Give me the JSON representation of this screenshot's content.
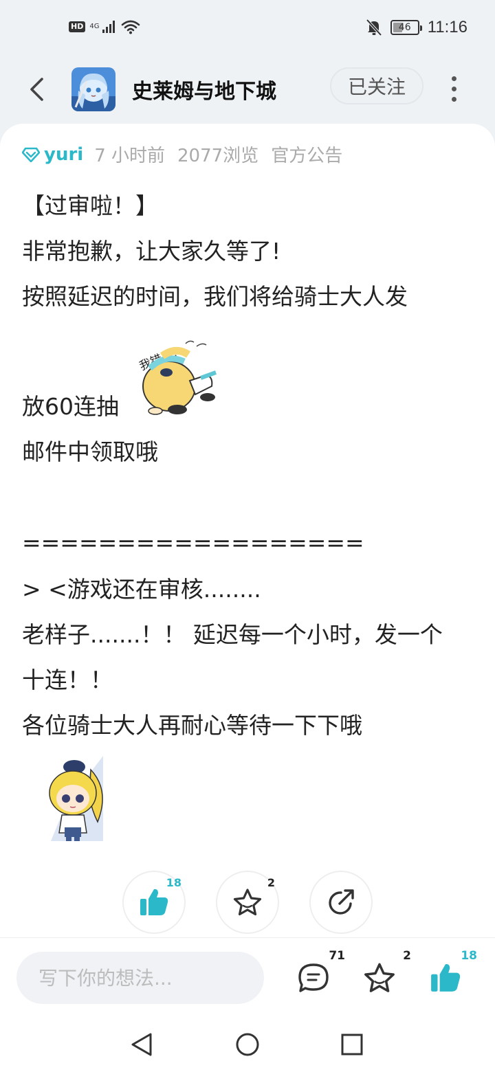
{
  "status_bar": {
    "hd_label": "HD",
    "signal_label": "4G",
    "battery_level": "46",
    "time": "11:16"
  },
  "header": {
    "title": "史莱姆与地下城",
    "follow_label": "已关注"
  },
  "post": {
    "author": "yuri",
    "time_ago": "7 小时前",
    "views": "2077浏览",
    "category": "官方公告",
    "lines": [
      "【过审啦！】",
      "非常抱歉，让大家久等了!",
      "按照延迟的时间，我们将给骑士大人发",
      "放60连抽",
      "邮件中领取哦",
      "==================",
      "> <游戏还在审核........",
      "老样子.......！！ 延迟每一个小时，发一个",
      "十连！！",
      "各位骑士大人再耐心等待一下下哦"
    ],
    "sticker_text": "我错了!"
  },
  "actions": {
    "like_count": "18",
    "favorite_count": "2"
  },
  "bottom_bar": {
    "placeholder": "写下你的想法...",
    "comment_count": "71",
    "favorite_count": "2",
    "like_count": "18"
  },
  "colors": {
    "accent": "#2bb8c9",
    "text": "#222222",
    "muted": "#aaaaaa",
    "background": "#eff2f5"
  },
  "icons": {
    "back": "chevron-left-icon",
    "more": "more-vertical-icon",
    "verified": "diamond-icon",
    "like": "thumbs-up-icon",
    "favorite": "star-icon",
    "share": "share-icon",
    "comment": "comment-icon"
  }
}
